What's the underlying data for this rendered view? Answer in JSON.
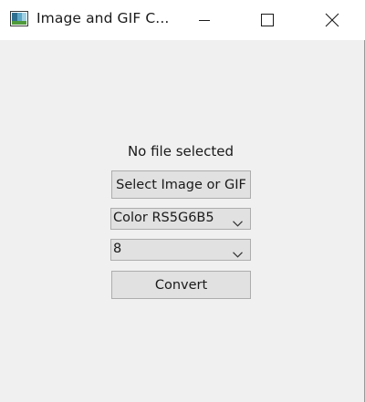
{
  "window": {
    "title": "Image and GIF C...",
    "controls": {
      "minimize": "minimize-icon",
      "maximize": "maximize-icon",
      "close": "close-icon"
    }
  },
  "main": {
    "status_text": "No file selected",
    "select_button_label": "Select Image or GIF",
    "color_format": {
      "selected": "Color RS5G6B5"
    },
    "bit_depth": {
      "selected": "8"
    },
    "convert_button_label": "Convert"
  },
  "colors": {
    "window_bg": "#f0f0f0",
    "titlebar_bg": "#ffffff",
    "button_bg": "#e1e1e1",
    "button_border": "#adadad"
  }
}
